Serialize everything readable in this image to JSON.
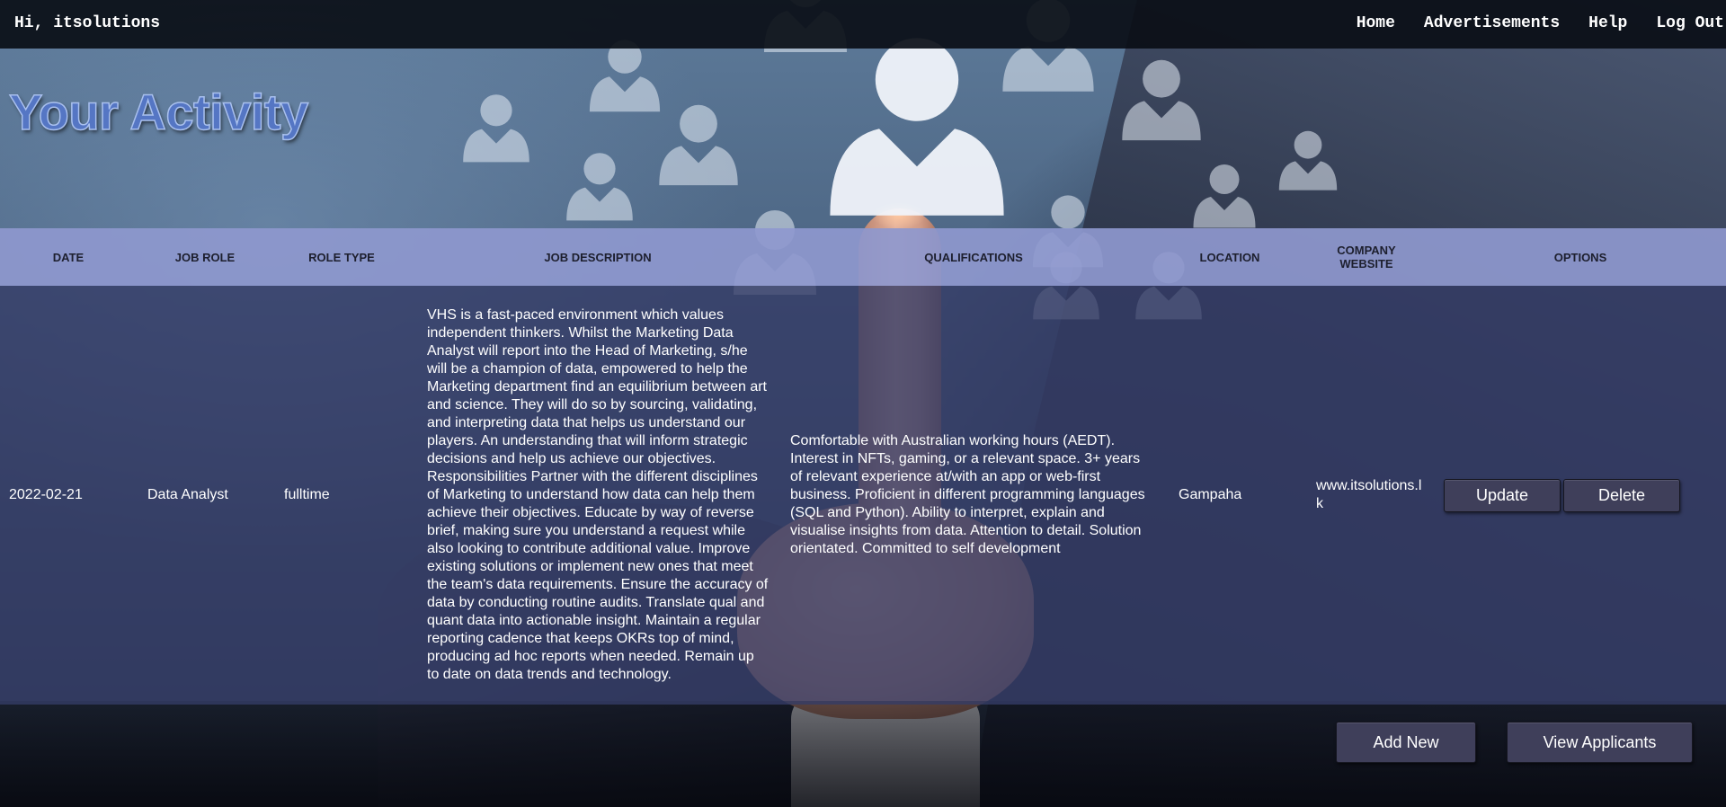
{
  "header": {
    "greeting": "Hi, itsolutions",
    "nav": [
      "Home",
      "Advertisements",
      "Help",
      "Log Out"
    ]
  },
  "page_title": "Your Activity",
  "table": {
    "columns": [
      "DATE",
      "JOB ROLE",
      "ROLE TYPE",
      "JOB DESCRIPTION",
      "QUALIFICATIONS",
      "LOCATION",
      "COMPANY WEBSITE",
      "OPTIONS"
    ],
    "rows": [
      {
        "date": "2022-02-21",
        "job_role": "Data Analyst",
        "role_type": "fulltime",
        "job_description": "VHS is a fast-paced environment which values independent thinkers. Whilst the Marketing Data Analyst will report into the Head of Marketing, s/he will be a champion of data, empowered to help the Marketing department find an equilibrium between art and science. They will do so by sourcing, validating, and interpreting data that helps us understand our players. An understanding that will inform strategic decisions and help us achieve our objectives. Responsibilities Partner with the different disciplines of Marketing to understand how data can help them achieve their objectives. Educate by way of reverse brief, making sure you understand a request while also looking to contribute additional value. Improve existing solutions or implement new ones that meet the team's data requirements. Ensure the accuracy of data by conducting routine audits. Translate qual and quant data into actionable insight. Maintain a regular reporting cadence that keeps OKRs top of mind, producing ad hoc reports when needed. Remain up to date on data trends and technology.",
        "qualifications": "Comfortable with Australian working hours (AEDT). Interest in NFTs, gaming, or a relevant space. 3+ years of relevant experience at/with an app or web-first business. Proficient in different programming languages (SQL and Python). Ability to interpret, explain and visualise insights from data. Attention to detail. Solution orientated. Committed to self development",
        "location": "Gampaha",
        "website": "www.itsolutions.lk",
        "update_label": "Update",
        "delete_label": "Delete"
      }
    ]
  },
  "actions": {
    "add_new": "Add New",
    "view_applicants": "View Applicants"
  },
  "colors": {
    "title": "#5576c4",
    "header_row": "#8e98ce",
    "body_row": "#343c66",
    "button": "#3f3f5a",
    "topbar": "#0a0e16"
  }
}
